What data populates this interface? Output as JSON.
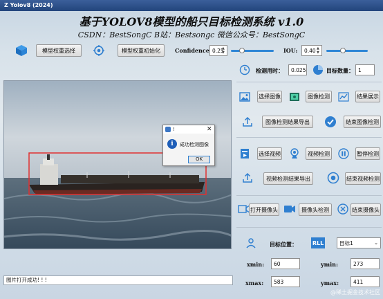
{
  "window": {
    "title": "Z Yolov8 (2024)"
  },
  "header": {
    "title": "基于YOLOV8模型的船只目标检测系统 v1.0",
    "subtitle": "CSDN：BestSongC   B站：Bestsongc   微信公众号：BestSongC"
  },
  "toolbar": {
    "select_weights": "模型权重选择",
    "init_weights": "模型权重初始化",
    "confidence_label": "Confidence:",
    "confidence_value": "0.25",
    "confidence_level": 0.25,
    "iou_label": "IOU:",
    "iou_value": "0.40",
    "iou_level": 0.4
  },
  "stats": {
    "time_label": "检测用时：",
    "time_value": "0.025",
    "count_label": "目标数量：",
    "count_value": "1"
  },
  "image_section": {
    "select_image": "选择图像",
    "image_detect": "图像检测",
    "show_result": "结果展示",
    "export_image": "图像检测结果导出",
    "end_image": "结束图像检测"
  },
  "video_section": {
    "select_video": "选择视频",
    "video_detect": "视频检测",
    "pause_detect": "暂停检测",
    "export_video": "视频检测结果导出",
    "end_video": "结束视频检测"
  },
  "camera_section": {
    "open_camera": "打开摄像头",
    "camera_detect": "摄像头检测",
    "end_camera": "结束摄像头"
  },
  "target": {
    "position_label": "目标位置：",
    "selected_target": "目标1",
    "xmin_label": "xmin:",
    "xmin_value": "60",
    "ymin_label": "ymin:",
    "ymin_value": "273",
    "xmax_label": "xmax:",
    "xmax_value": "583",
    "ymax_label": "ymax:",
    "ymax_value": "411"
  },
  "dialog": {
    "title": "!",
    "message": "成功检测图像",
    "ok_label": "OK"
  },
  "status": {
    "message": "图片打开成功! ! !"
  },
  "watermark": "@稀土掘金技术社区"
}
